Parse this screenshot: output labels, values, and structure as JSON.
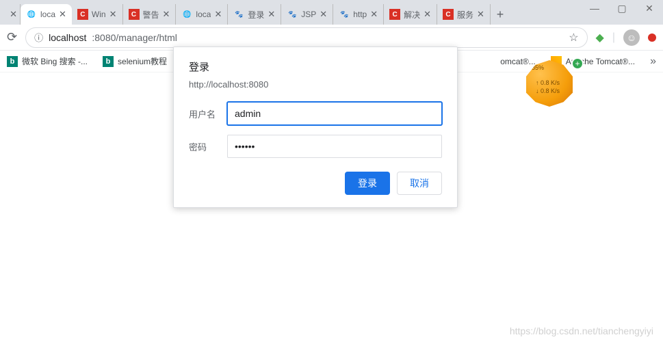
{
  "window_controls": {
    "min": "—",
    "max": "▢",
    "close": "✕"
  },
  "tabs": [
    {
      "label": "",
      "favicon": "globe",
      "close": "✕",
      "partial": true
    },
    {
      "label": "loca",
      "favicon": "globe",
      "close": "✕",
      "active": true
    },
    {
      "label": "Win",
      "favicon": "red-c",
      "close": "✕"
    },
    {
      "label": "警告",
      "favicon": "red-c",
      "close": "✕"
    },
    {
      "label": "loca",
      "favicon": "globe",
      "close": "✕"
    },
    {
      "label": "登录",
      "favicon": "paw",
      "close": "✕"
    },
    {
      "label": "JSP",
      "favicon": "paw",
      "close": "✕"
    },
    {
      "label": "http",
      "favicon": "paw",
      "close": "✕"
    },
    {
      "label": "解决",
      "favicon": "red-c",
      "close": "✕"
    },
    {
      "label": "服务",
      "favicon": "red-c",
      "close": "✕"
    }
  ],
  "newtab": "+",
  "url": {
    "reload": "⟳",
    "info": "ⓘ",
    "host": "localhost",
    "port_path": ":8080/manager/html",
    "star": "☆"
  },
  "right_icons": {
    "ext": "",
    "profile": "",
    "alert": ""
  },
  "bookmarks": [
    {
      "icon": "teal-b",
      "label": "微软 Bing 搜索 -..."
    },
    {
      "icon": "teal-b",
      "label": "selenium教程"
    },
    {
      "icon": "none",
      "label": "omcat®..."
    },
    {
      "icon": "orange",
      "label": "Apache Tomcat®..."
    }
  ],
  "bookmarks_more": "»",
  "dialog": {
    "title": "登录",
    "origin": "http://localhost:8080",
    "username_label": "用户名",
    "username_value": "admin",
    "password_label": "密码",
    "password_value": "••••••",
    "login_button": "登录",
    "cancel_button": "取消"
  },
  "widget": {
    "percent": "85%",
    "up": "↑  0.8 K/s",
    "down": "↓  0.8 K/s",
    "plus": "+"
  },
  "watermark": "https://blog.csdn.net/tianchengyiyi"
}
